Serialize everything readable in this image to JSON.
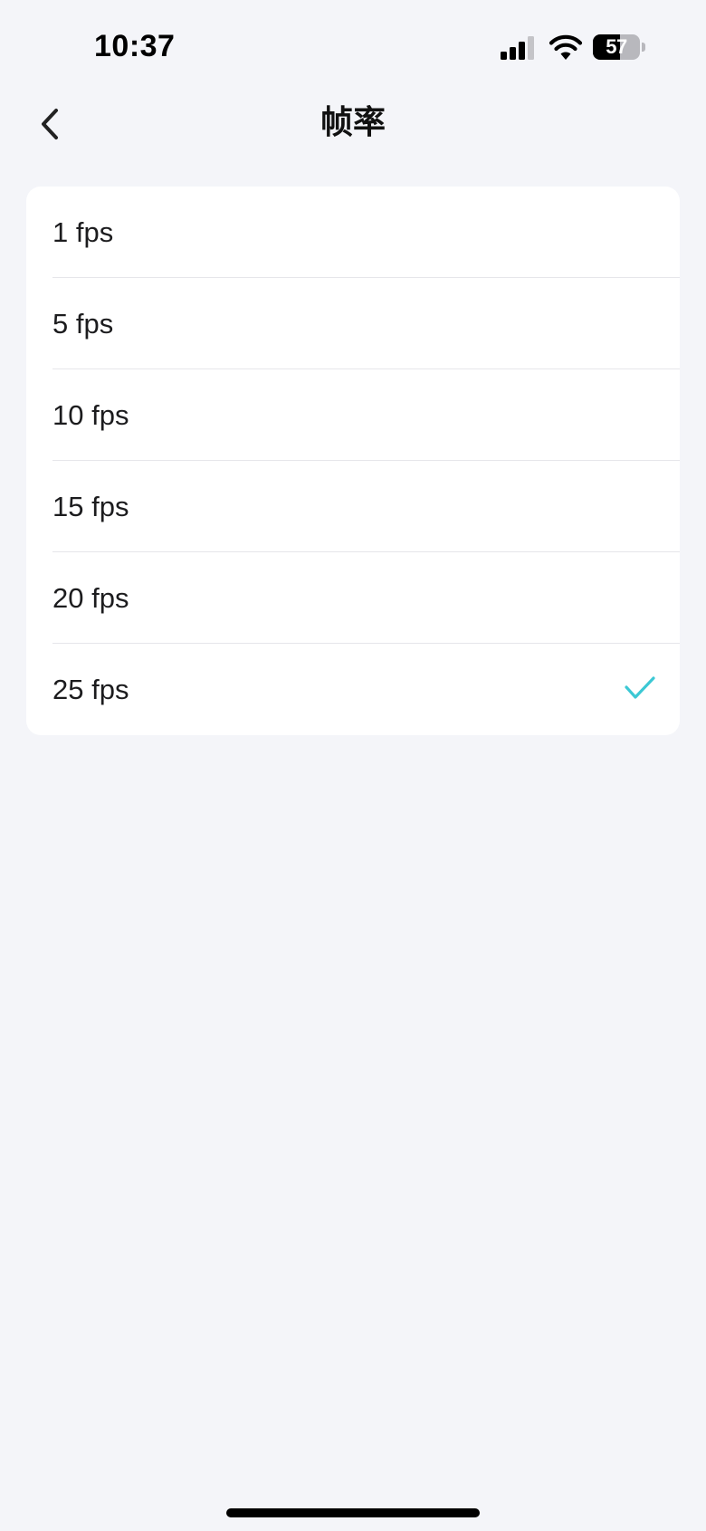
{
  "status_bar": {
    "time": "10:37",
    "battery_level": "57",
    "battery_fraction": 0.57
  },
  "nav": {
    "title": "帧率",
    "back_icon": "chevron-left-icon"
  },
  "options": [
    {
      "label": "1 fps",
      "selected": false
    },
    {
      "label": "5 fps",
      "selected": false
    },
    {
      "label": "10 fps",
      "selected": false
    },
    {
      "label": "15 fps",
      "selected": false
    },
    {
      "label": "20 fps",
      "selected": false
    },
    {
      "label": "25 fps",
      "selected": true
    }
  ],
  "colors": {
    "accent": "#3cc8d4",
    "background": "#f4f5f9",
    "card": "#ffffff"
  }
}
